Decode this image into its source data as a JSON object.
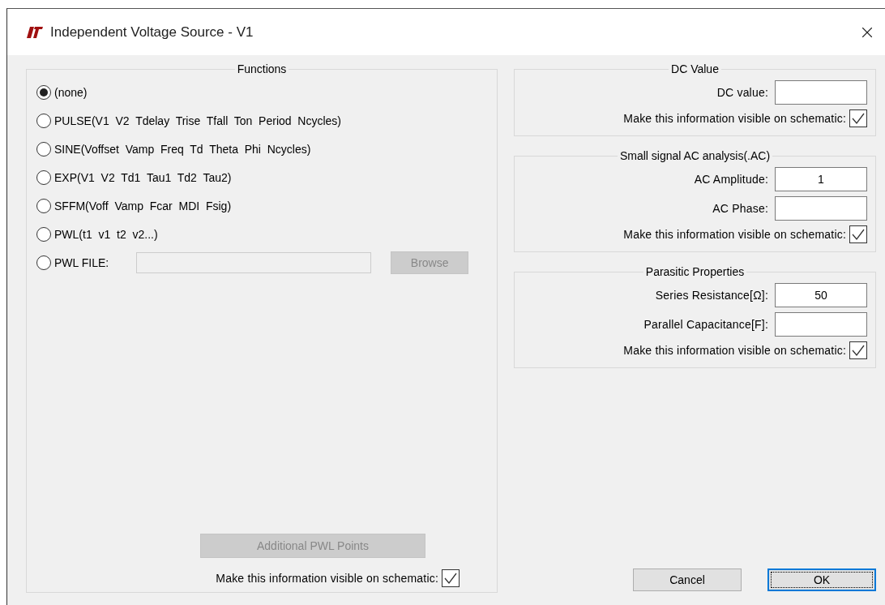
{
  "window": {
    "title": "Independent Voltage Source - V1"
  },
  "functions": {
    "title": "Functions",
    "options": [
      {
        "kind": "plain",
        "label": "(none)",
        "selected": true
      },
      {
        "kind": "plain",
        "label": "PULSE(V1  V2  Tdelay  Trise  Tfall  Ton  Period  Ncycles)",
        "selected": false
      },
      {
        "kind": "plain",
        "label": "SINE(Voffset  Vamp  Freq  Td  Theta  Phi  Ncycles)",
        "selected": false
      },
      {
        "kind": "plain",
        "label": "EXP(V1  V2  Td1  Tau1  Td2  Tau2)",
        "selected": false
      },
      {
        "kind": "plain",
        "label": "SFFM(Voff  Vamp  Fcar  MDI  Fsig)",
        "selected": false
      },
      {
        "kind": "plain",
        "label": "PWL(t1  v1  t2  v2...)",
        "selected": false
      },
      {
        "kind": "file",
        "label": "PWL FILE:",
        "selected": false,
        "field_disabled": true,
        "button": {
          "label": "Browse",
          "disabled": true
        }
      }
    ],
    "additional": {
      "label": "Additional PWL Points",
      "disabled": true
    },
    "visible": {
      "label": "Make this information visible on schematic:",
      "checked": true
    }
  },
  "groups": [
    {
      "title": "DC Value",
      "fields": [
        {
          "label": "DC value:"
        }
      ],
      "visible": {
        "label": "Make this information visible on schematic:",
        "checked": true
      }
    },
    {
      "title": "Small signal AC analysis(.AC)",
      "fields": [
        {
          "label": "AC Amplitude:",
          "value": "1"
        },
        {
          "label": "AC Phase:"
        }
      ],
      "visible": {
        "label": "Make this information visible on schematic:",
        "checked": true
      }
    },
    {
      "title": "Parasitic Properties",
      "fields": [
        {
          "label": "Series Resistance[Ω]:",
          "value": "50"
        },
        {
          "label": "Parallel Capacitance[F]:"
        }
      ],
      "visible": {
        "label": "Make this information visible on schematic:",
        "checked": true
      }
    }
  ],
  "buttons": [
    {
      "label": "Cancel",
      "default": false
    },
    {
      "label": "OK",
      "default": true
    }
  ]
}
